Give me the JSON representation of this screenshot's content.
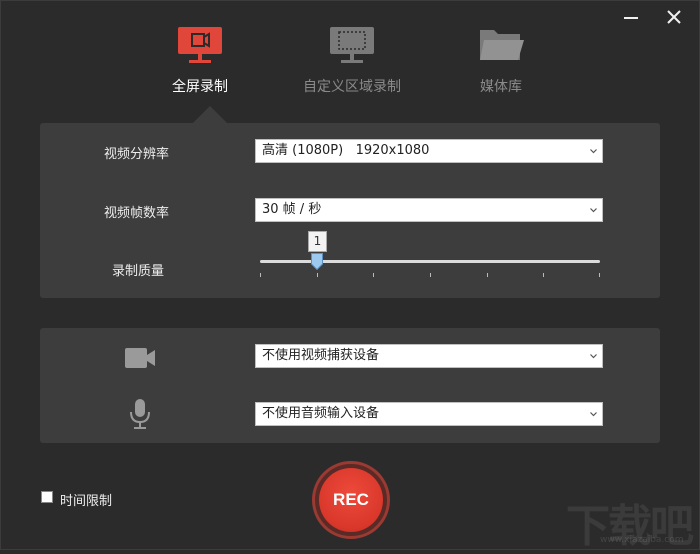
{
  "window": {
    "minimize_label": "minimize",
    "close_label": "close"
  },
  "tabs": [
    {
      "label": "全屏录制",
      "icon": "monitor-record-icon",
      "active": true
    },
    {
      "label": "自定义区域录制",
      "icon": "monitor-region-icon",
      "active": false
    },
    {
      "label": "媒体库",
      "icon": "folder-icon",
      "active": false
    }
  ],
  "settings": {
    "resolution": {
      "label": "视频分辨率",
      "value": "高清 (1080P)   1920x1080"
    },
    "framerate": {
      "label": "视频帧数率",
      "value": "30 帧 / 秒"
    },
    "quality": {
      "label": "录制质量",
      "value": "1",
      "position_fraction": 0.167
    }
  },
  "devices": {
    "camera": {
      "icon": "camera-icon",
      "value": "不使用视频捕获设备"
    },
    "microphone": {
      "icon": "microphone-icon",
      "value": "不使用音频输入设备"
    }
  },
  "bottom": {
    "time_limit_label": "时间限制",
    "time_limit_checked": false,
    "rec_label": "REC"
  },
  "watermark": {
    "text": "下载吧",
    "url": "www.xiazaiba.com"
  },
  "colors": {
    "accent": "#e0473a",
    "panel": "#3d3d3d",
    "background": "#2b2b2b"
  }
}
